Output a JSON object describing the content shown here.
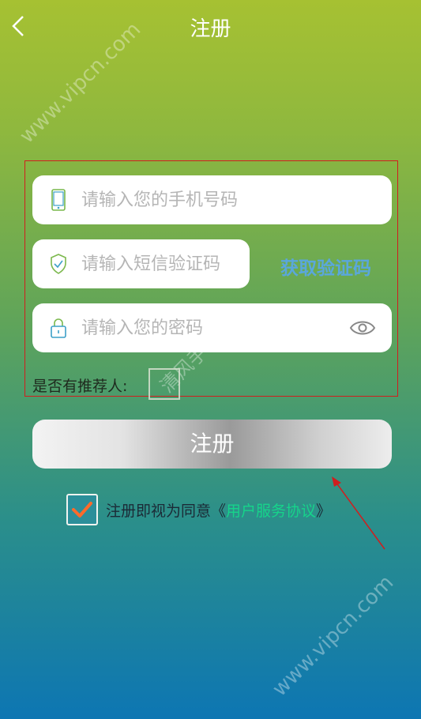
{
  "header": {
    "back_icon": "chevron-left-icon",
    "title": "注册"
  },
  "form": {
    "phone": {
      "placeholder": "请输入您的手机号码",
      "icon": "phone-icon"
    },
    "sms_code": {
      "placeholder": "请输入短信验证码",
      "icon": "shield-check-icon"
    },
    "get_code_label": "获取验证码",
    "password": {
      "placeholder": "请输入您的密码",
      "icon": "lock-icon",
      "toggle_icon": "eye-icon"
    },
    "referrer_label": "是否有推荐人:"
  },
  "register_button": "注册",
  "agreement": {
    "checked": true,
    "prefix": "注册即视为同意《",
    "link": "用户服务协议",
    "suffix": "》"
  },
  "watermarks": {
    "top": "www.vipcn.com",
    "middle": "清风手",
    "bottom": "www.vipcn.com"
  },
  "colors": {
    "accent_link": "#16d48a",
    "get_code": "#5aa7dc",
    "annotation": "#d01e1e",
    "check": "#ff6a2a"
  }
}
